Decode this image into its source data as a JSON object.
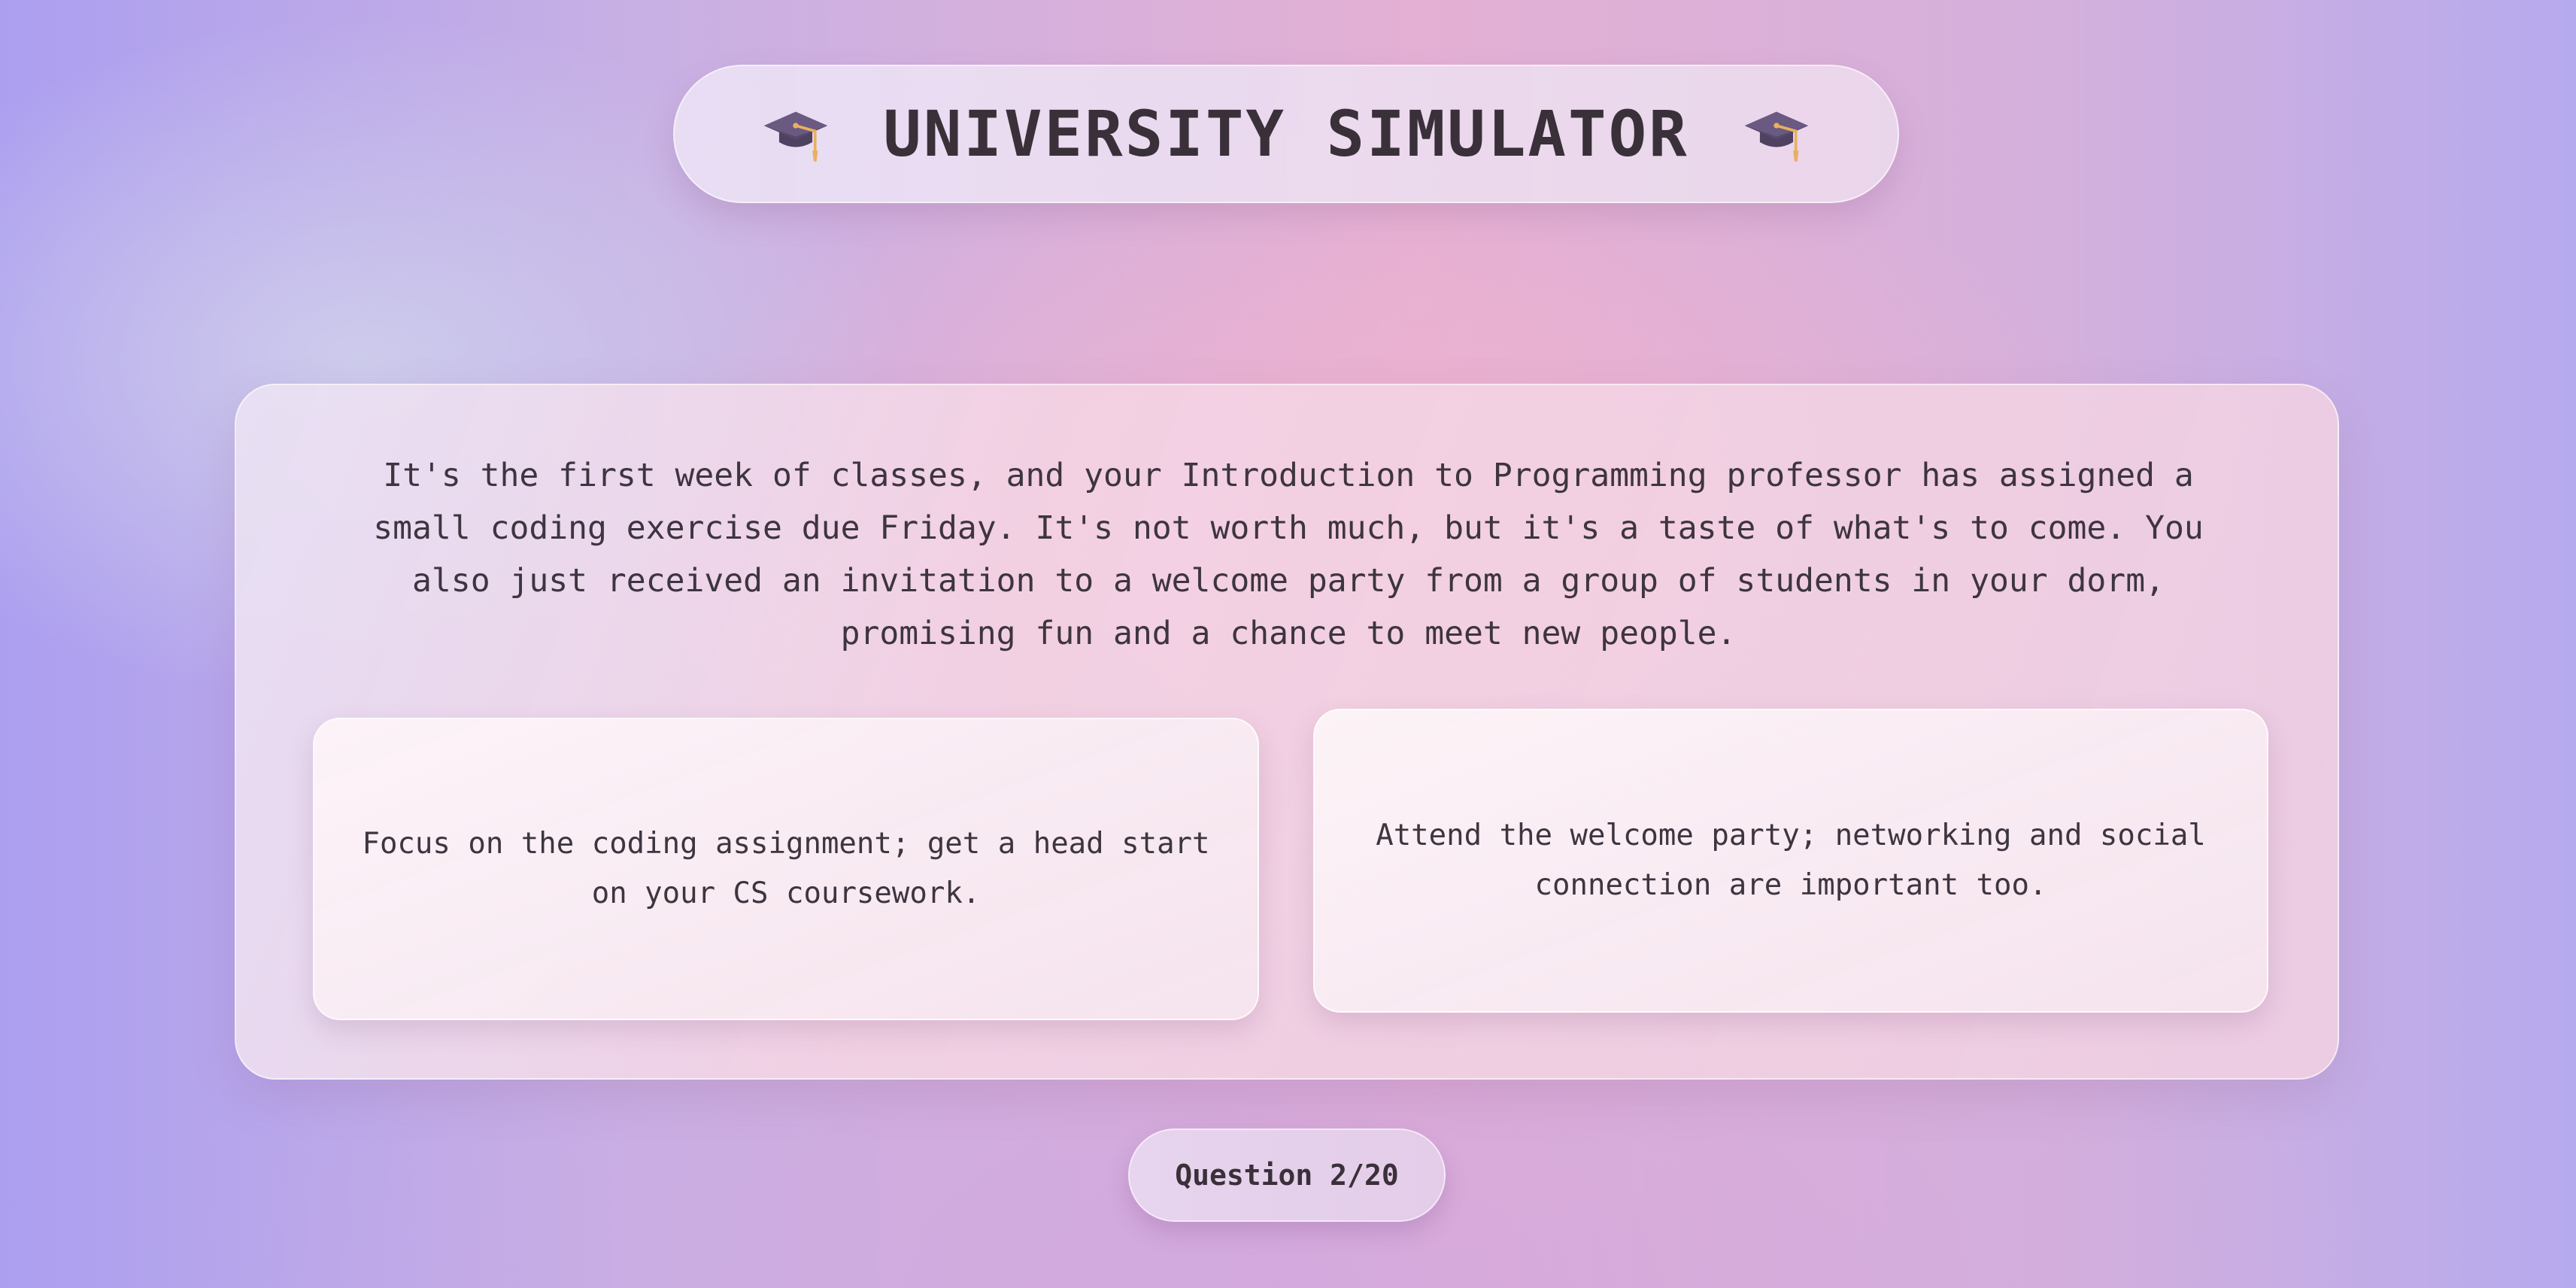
{
  "header": {
    "title": "UNIVERSITY SIMULATOR",
    "left_icon": "graduation-cap-icon",
    "right_icon": "graduation-cap-icon"
  },
  "scenario": {
    "text": "It's the first week of classes, and your Introduction to Programming professor has assigned a small coding exercise due Friday. It's not worth much, but it's a taste of what's to come. You also just received an invitation to a welcome party from a group of students in your dorm, promising fun and a chance to meet new people."
  },
  "choices": [
    {
      "label": "Focus on the coding assignment; get a head start on your CS coursework."
    },
    {
      "label": "Attend the welcome party; networking and social connection are important too."
    }
  ],
  "progress": {
    "label": "Question 2/20",
    "current": 2,
    "total": 20
  },
  "colors": {
    "text": "#3a3039",
    "cap": "#5e4e72",
    "tassel": "#e8b060"
  }
}
